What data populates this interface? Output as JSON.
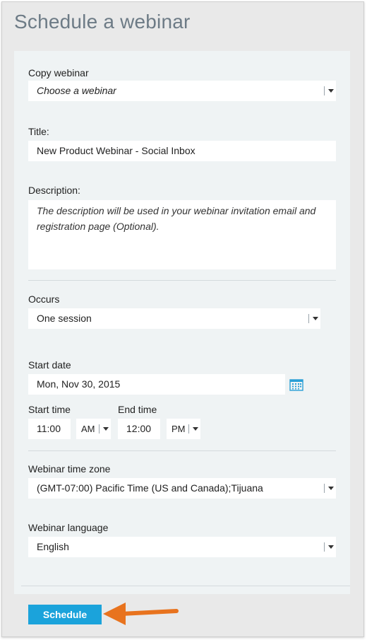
{
  "page": {
    "title": "Schedule a webinar"
  },
  "form": {
    "copy_webinar": {
      "label": "Copy webinar",
      "value": "Choose a webinar"
    },
    "title": {
      "label": "Title:",
      "value": "New Product Webinar - Social Inbox"
    },
    "description": {
      "label": "Description:",
      "placeholder": "The description will be used in your webinar invitation email and registration page (Optional)."
    },
    "occurs": {
      "label": "Occurs",
      "value": "One session"
    },
    "start_date": {
      "label": "Start date",
      "value": "Mon, Nov 30, 2015"
    },
    "start_time": {
      "label": "Start time",
      "value": "11:00",
      "ampm": "AM"
    },
    "end_time": {
      "label": "End time",
      "value": "12:00",
      "ampm": "PM"
    },
    "time_zone": {
      "label": "Webinar time zone",
      "value": "(GMT-07:00) Pacific Time (US and Canada);Tijuana"
    },
    "language": {
      "label": "Webinar language",
      "value": "English"
    }
  },
  "actions": {
    "schedule_label": "Schedule"
  },
  "icons": {
    "calendar": "calendar-icon",
    "dropdown": "chevron-down-icon",
    "annotation": "orange-arrow"
  },
  "colors": {
    "accent": "#1ba3db",
    "annotation": "#e8731e",
    "title": "#6d7b86"
  }
}
